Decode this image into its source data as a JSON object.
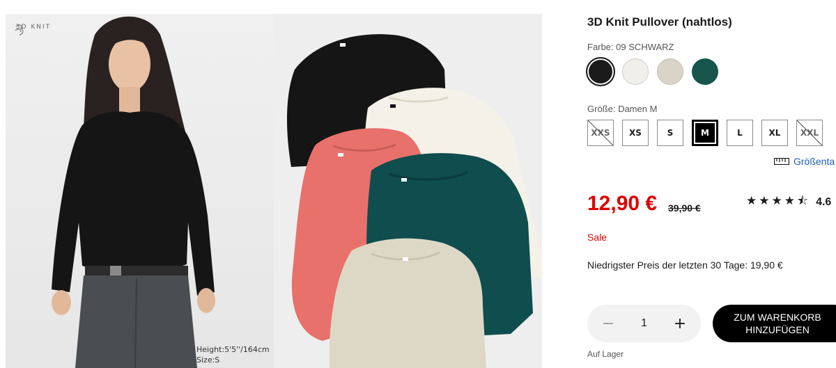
{
  "gallery": {
    "badge_text": "3D KNIT",
    "model_note": [
      "Height:5'5''/164cm",
      "Size:S"
    ],
    "colors": {
      "black": "#151515",
      "white": "#f4f1e8",
      "coral": "#e8716c",
      "teal": "#0f4d4e",
      "beige": "#ddd8c6"
    }
  },
  "product": {
    "title": "3D Knit Pullover (nahtlos)",
    "color_label": "Farbe: 09 SCHWARZ",
    "swatches": [
      {
        "color": "#1b1b1b",
        "selected": true
      },
      {
        "color": "#f1efea",
        "selected": false
      },
      {
        "color": "#d9d4c5",
        "selected": false
      },
      {
        "color": "#16544c",
        "selected": false
      }
    ],
    "size_label": "Größe: Damen M",
    "sizes": [
      {
        "label": "XXS",
        "available": false
      },
      {
        "label": "XS",
        "available": true
      },
      {
        "label": "S",
        "available": true
      },
      {
        "label": "M",
        "available": true,
        "selected": true
      },
      {
        "label": "L",
        "available": true
      },
      {
        "label": "XL",
        "available": true
      },
      {
        "label": "XXL",
        "available": false
      }
    ],
    "size_guide": "Größenta",
    "price": "12,90 €",
    "old_price": "39,90 €",
    "rating_stars": "★★★★⯪",
    "rating_value": "4.6",
    "sale_label": "Sale",
    "lowest_price": "Niedrigster Preis der letzten 30 Tage: 19,90 €",
    "quantity": "1",
    "qty_minus": "−",
    "qty_plus": "+",
    "cart_button": [
      "ZUM WARENKORB",
      "HINZUFÜGEN"
    ],
    "stock": "Auf Lager"
  }
}
